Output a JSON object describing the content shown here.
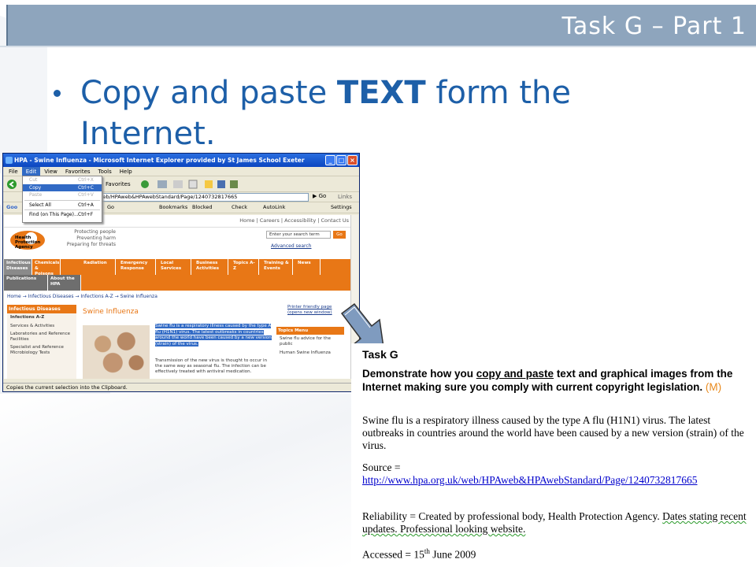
{
  "slide": {
    "title": "Task G – Part 1",
    "bullet_prefix": "Copy and paste ",
    "bullet_bold": "TEXT",
    "bullet_suffix": " form the Internet."
  },
  "browser": {
    "window_title": "HPA - Swine Influenza - Microsoft Internet Explorer provided by St James School Exeter",
    "menu": [
      "File",
      "Edit",
      "View",
      "Favorites",
      "Tools",
      "Help"
    ],
    "active_menu": "Edit",
    "edit_menu": [
      {
        "label": "Cut",
        "shortcut": "Ctrl+X",
        "state": "disabled"
      },
      {
        "label": "Copy",
        "shortcut": "Ctrl+C",
        "state": "selected"
      },
      {
        "label": "Paste",
        "shortcut": "Ctrl+V",
        "state": "disabled"
      },
      {
        "label": "Select All",
        "shortcut": "Ctrl+A",
        "state": "normal"
      },
      {
        "label": "Find (on This Page)...",
        "shortcut": "Ctrl+F",
        "state": "normal"
      }
    ],
    "address_fragment": "/web/HPAweb&HPAwebStandard/Page/1240732817665",
    "go_label": "Go",
    "links_label": "Links",
    "toolbar_favorites": "Favorites",
    "google_items": [
      "Go",
      "Bookmarks",
      "Blocked",
      "Check",
      "AutoLink",
      "Settings"
    ],
    "status_text": "Copies the current selection into the Clipboard."
  },
  "hpa_page": {
    "top_links": "Home | Careers | Accessibility | Contact Us",
    "logo_text": "Health Protection Agency",
    "tagline": [
      "Protecting people",
      "Preventing harm",
      "Preparing for threats"
    ],
    "search_placeholder": "Enter your search term",
    "search_go": "Go",
    "advanced_search": "Advanced search",
    "nav_tabs": [
      "Infectious Diseases",
      "Chemicals & Poisons",
      "Radiation",
      "Emergency Response",
      "Local Services",
      "Business Activities",
      "Topics A-Z",
      "Training & Events",
      "News"
    ],
    "nav_tabs_row2": [
      "Publications",
      "About the HPA"
    ],
    "breadcrumb": "Home → Infectious Diseases → Infections A-Z → Swine Influenza",
    "side_heading": "Infectious Diseases",
    "side_items": [
      "Infections A-Z",
      "Services & Activities",
      "Laboratories and Reference Facilities",
      "Specialist and Reference Microbiology Tests"
    ],
    "heading": "Swine Influenza",
    "selected_text": "Swine flu is a respiratory illness caused by the type A flu (H1N1) virus. The latest outbreaks in countries around the world have been caused by a new version (strain) of the virus.",
    "more_text": "Transmission of the new virus is thought to occur in the same way as seasonal flu. The infection can be effectively treated with antiviral medication.",
    "printer_friendly": "Printer friendly page (opens new window)",
    "topics_menu": "Topics Menu",
    "topics_items": [
      "Swine flu advice for the public",
      "Human Swine Influenza"
    ]
  },
  "document": {
    "heading": "Task G",
    "p1_before": "Demonstrate how you ",
    "p1_link": "copy and paste",
    "p1_after": " text and graphical images from the Internet making sure you comply with current copyright legislation.",
    "p1_marker": "(M)",
    "quote": "Swine flu is a respiratory illness caused by the type A flu (H1N1) virus. The latest outbreaks in countries around the world have been caused by a new version (strain) of the virus.",
    "source_label": "Source =",
    "source_url": "http://www.hpa.org.uk/web/HPAweb&HPAwebStandard/Page/1240732817665",
    "reliability_prefix": "Reliability = Created by professional body, Health Protection Agency. ",
    "reliability_underlined": "Dates stating recent updates. Professional looking website.",
    "accessed_prefix": "Accessed = 15",
    "accessed_sup": "th",
    "accessed_suffix": " June 2009"
  }
}
